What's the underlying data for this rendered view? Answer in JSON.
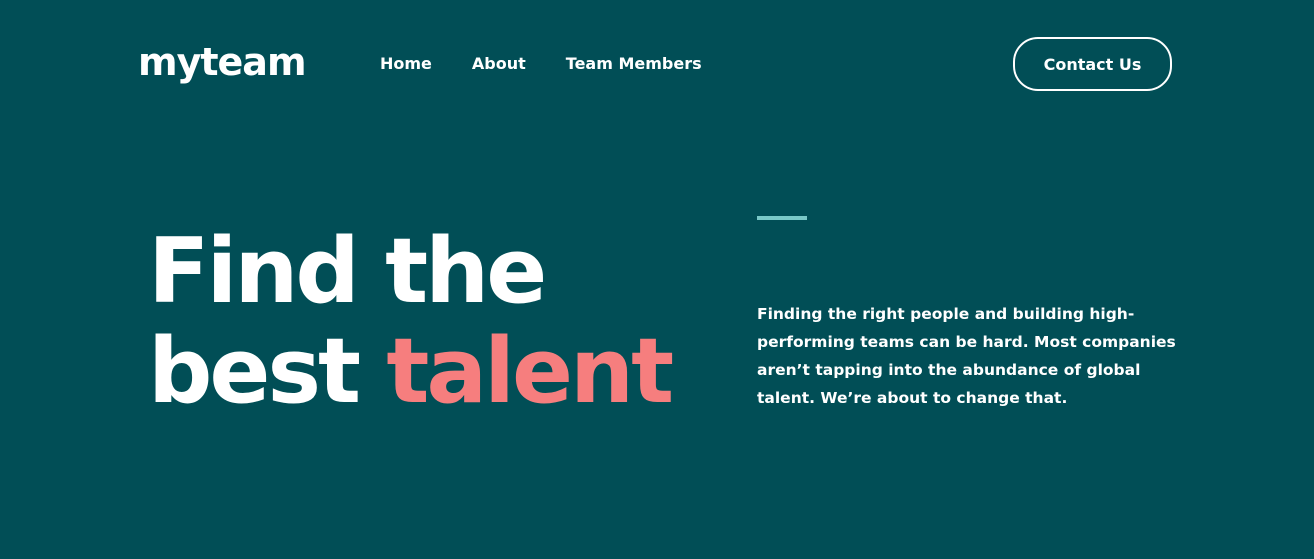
{
  "header": {
    "logo": "myteam",
    "nav": {
      "home": "Home",
      "about": "About",
      "team_members": "Team Members"
    },
    "contact_label": "Contact Us"
  },
  "hero": {
    "title_line1": "Find the",
    "title_line2_plain": "best",
    "title_line2_accent": "talent",
    "description": "Finding the right people and building high-performing teams can be hard. Most companies aren’t tapping into the abundance of global talent. We’re about to change that."
  },
  "colors": {
    "background": "#014e56",
    "accent": "#f67e7e",
    "line": "#79c8c7",
    "text": "#ffffff"
  }
}
